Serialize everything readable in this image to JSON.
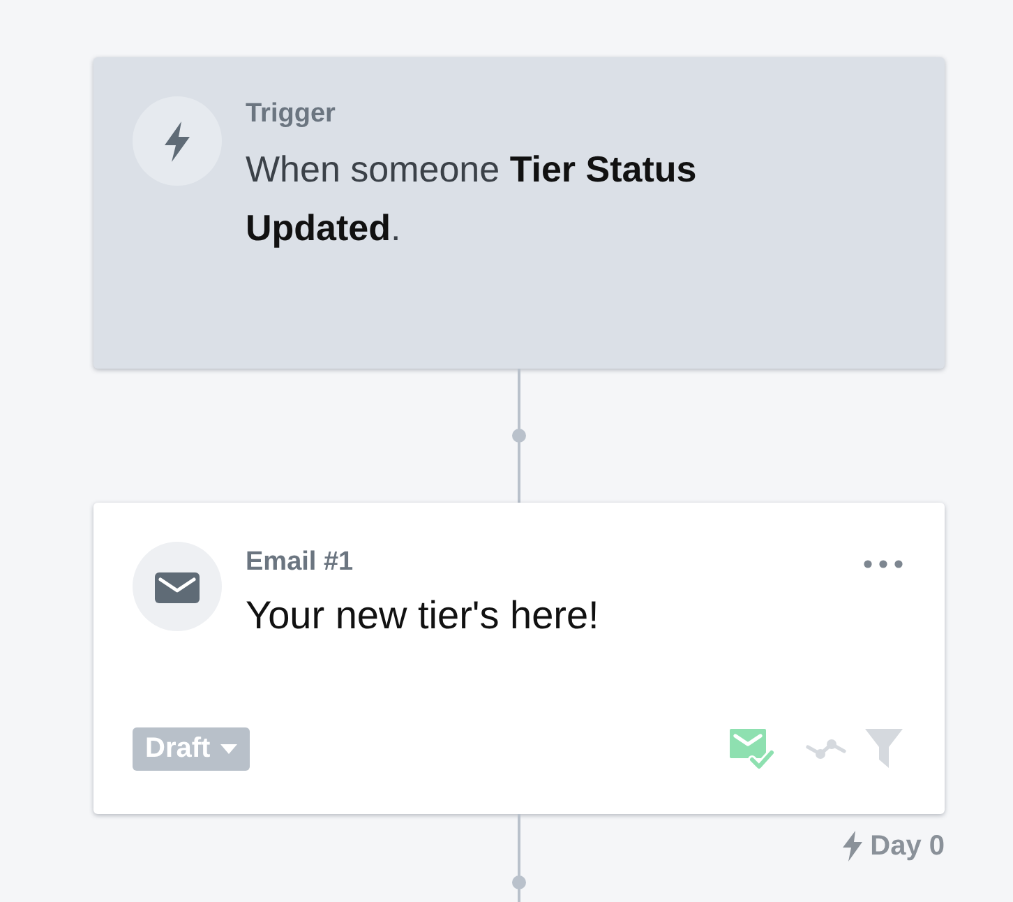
{
  "trigger": {
    "label": "Trigger",
    "text": "When someone **Tier Status Updated**."
  },
  "email": {
    "label": "Email #1",
    "subject": "Your new tier's here!",
    "status": {
      "label": "Draft"
    },
    "indicators": [
      {
        "kind": "content-check",
        "on": true
      },
      {
        "kind": "split",
        "on": false
      },
      {
        "kind": "filter",
        "on": false
      }
    ]
  },
  "delay": {
    "label": "Day 0"
  }
}
